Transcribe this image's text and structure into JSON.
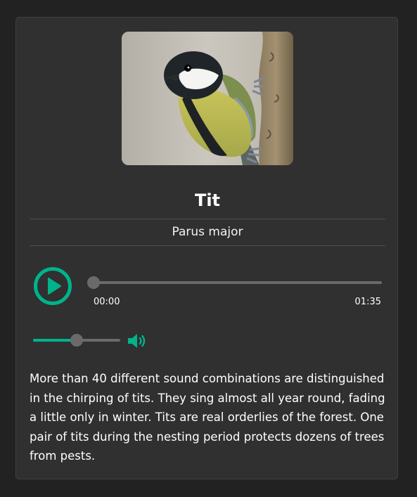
{
  "bird": {
    "name": "Tit",
    "latin": "Parus major",
    "description": "More than 40 different sound combinations are distinguished in the chirping of tits. They sing almost all year round, fading a little only in winter. Tits are real orderlies of the forest. One pair of tits during the nesting period protects dozens of trees from pests."
  },
  "player": {
    "current_time": "00:00",
    "duration": "01:35",
    "progress": 0.0,
    "volume": 0.5,
    "play_icon": "play-icon",
    "volume_icon": "speaker-volume-icon"
  },
  "colors": {
    "background": "#222222",
    "card": "#303030",
    "accent": "#00b38a",
    "slider_track": "#6a6a6a"
  }
}
